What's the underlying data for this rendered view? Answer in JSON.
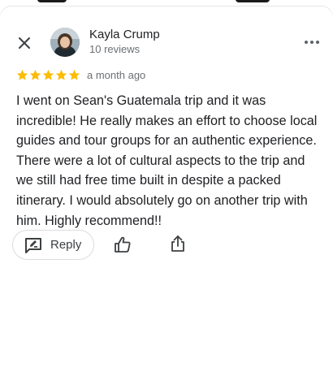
{
  "reviewer": {
    "name": "Kayla Crump",
    "review_count": "10 reviews"
  },
  "review": {
    "rating": 5,
    "max_rating": 5,
    "time": "a month ago",
    "text": "I went on Sean's Guatemala trip and it was incredible! He really makes an effort to choose local guides and tour groups for an authentic experience. There were a lot of cultural aspects to the trip and we still had free time built in despite a packed itinerary. I would absolutely go on another trip with him. Highly recommend!!"
  },
  "actions": {
    "reply_label": "Reply"
  },
  "icons": {
    "close": "close-icon",
    "more": "more-vert-icon",
    "star": "star-icon",
    "reply": "reply-icon",
    "like": "thumb-up-icon",
    "share": "share-icon"
  },
  "colors": {
    "star": "#fbbc04",
    "text": "#202124",
    "secondary_text": "#6b6f73",
    "border": "#dadce0"
  }
}
